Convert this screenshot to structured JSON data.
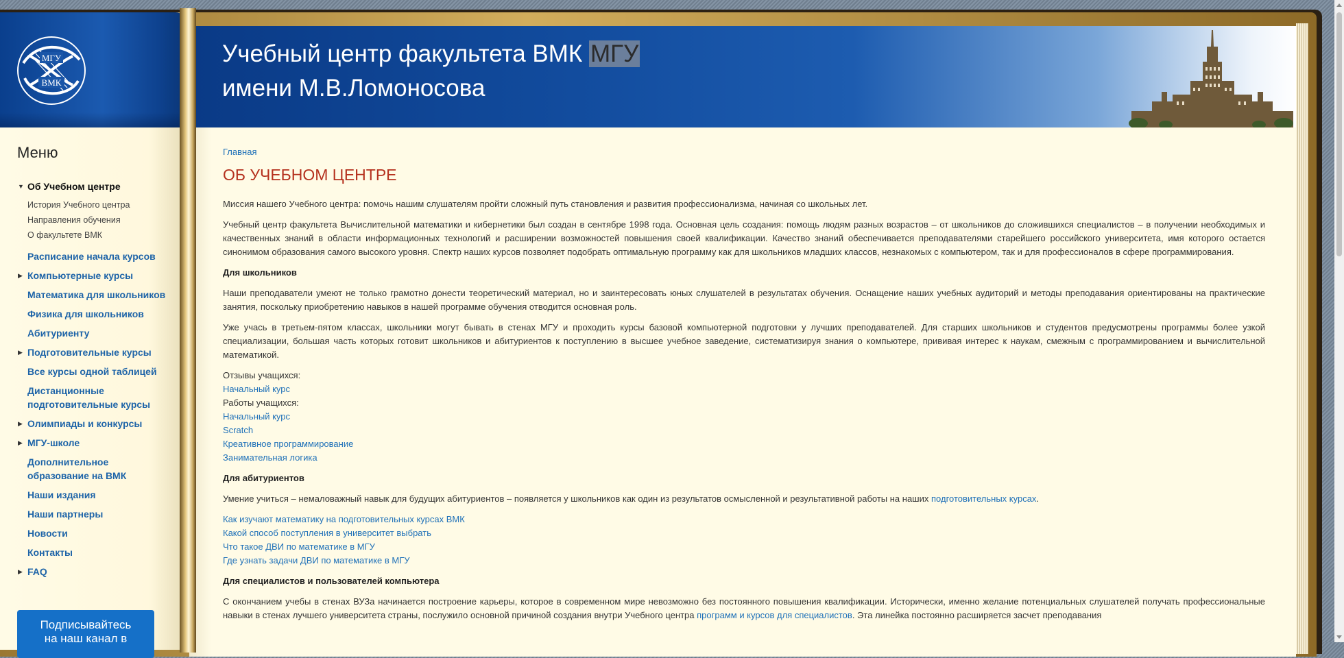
{
  "header": {
    "title_line1_prefix": "Учебный центр факультета ВМК ",
    "title_line1_highlight": "МГУ",
    "title_line2": "имени М.В.Ломоносова",
    "logo_text_top": "МГУ",
    "logo_text_bottom": "ВМК"
  },
  "sidebar": {
    "menu_title": "Меню",
    "items": [
      {
        "label": "Об Учебном центре",
        "expanded": true,
        "sub": [
          "История Учебного центра",
          "Направления обучения",
          "О факультете ВМК"
        ]
      },
      {
        "label": "Расписание начала курсов"
      },
      {
        "label": "Компьютерные курсы",
        "collapsed": true
      },
      {
        "label": "Математика для школьников"
      },
      {
        "label": "Физика для школьников"
      },
      {
        "label": "Абитуриенту"
      },
      {
        "label": "Подготовительные курсы",
        "collapsed": true
      },
      {
        "label": "Все курсы одной таблицей"
      },
      {
        "label": "Дистанционные подготовительные курсы"
      },
      {
        "label": "Олимпиады и конкурсы",
        "collapsed": true
      },
      {
        "label": "МГУ-школе",
        "collapsed": true
      },
      {
        "label": "Дополнительное образование на ВМК"
      },
      {
        "label": "Наши издания"
      },
      {
        "label": "Наши партнеры"
      },
      {
        "label": "Новости"
      },
      {
        "label": "Контакты"
      },
      {
        "label": "FAQ",
        "collapsed": true
      }
    ],
    "subscribe_line1": "Подписывайтесь",
    "subscribe_line2": "на наш канал в"
  },
  "content": {
    "breadcrumb": "Главная",
    "heading": "ОБ УЧЕБНОМ ЦЕНТРЕ",
    "p1": "Миссия нашего Учебного центра: помочь нашим слушателям пройти сложный путь становления и развития профессионализма, начиная со школьных лет.",
    "p2": "Учебный центр факультета Вычислительной математики и кибернетики был создан в сентябре 1998 года. Основная цель создания: помощь людям разных возрастов – от школьников до сложившихся специалистов – в получении необходимых и качественных знаний в области информационных технологий и расширении возможностей повышения своей квалификации. Качество знаний обеспечивается преподавателями старейшего российского университета, имя которого остается синонимом образования самого высокого уровня. Спектр наших курсов позволяет подобрать оптимальную программу как для школьников младших классов, незнакомых с компьютером, так и для профессионалов в сфере программирования.",
    "h_school": "Для школьников",
    "p3": "Наши преподаватели умеют не только грамотно донести теоретический материал, но и заинтересовать юных слушателей в результатах обучения. Оснащение наших учебных аудиторий и методы преподавания ориентированы на практические занятия, поскольку приобретению навыков в нашей программе обучения отводится основная роль.",
    "p4": "Уже учась в третьем-пятом классах, школьники могут бывать в стенах МГУ и проходить курсы базовой компьютерной подготовки у лучших преподавателей. Для старших школьников и студентов предусмотрены программы более узкой специализации, большая часть которых готовит школьников и абитуриентов к поступлению в высшее учебное заведение, систематизируя знания о компьютере, прививая интерес к наукам, смежным с программированием и вычислительной математикой.",
    "reviews_label": "Отзывы учащихся:",
    "reviews_link": "Начальный курс",
    "works_label": "Работы учащихся:",
    "works_links": [
      "Начальный курс",
      "Scratch",
      "Креативное программирование",
      "Занимательная логика"
    ],
    "h_applicants": "Для абитуриентов",
    "p5_text": "Умение учиться – немаловажный навык для будущих абитуриентов – появляется у школьников как один из результатов осмысленной и результативной работы на наших ",
    "p5_link": "подготовительных курсах",
    "p5_end": ".",
    "applicant_links": [
      "Как изучают математику на подготовительных курсах ВМК",
      "Какой способ поступления в университет выбрать",
      "Что такое ДВИ по математике в МГУ",
      "Где узнать задачи ДВИ по математике в МГУ"
    ],
    "h_specialists": "Для специалистов и пользователей компьютера",
    "p6_text": "С окончанием учебы в стенах ВУЗа начинается построение карьеры, которое в современном мире невозможно без постоянного повышения квалификации. Исторически, именно желание потенциальных слушателей получать профессиональные навыки в стенах лучшего университета страны, послужило основной причиной создания внутри Учебного центра ",
    "p6_link": "программ и курсов для специалистов",
    "p6_end": ". Эта линейка постоянно расширяется засчет преподавания"
  },
  "colors": {
    "banner_blue": "#124c9e",
    "heading_red": "#b5311e",
    "link_blue": "#1e70b8",
    "page_cream": "#fffbe6"
  }
}
